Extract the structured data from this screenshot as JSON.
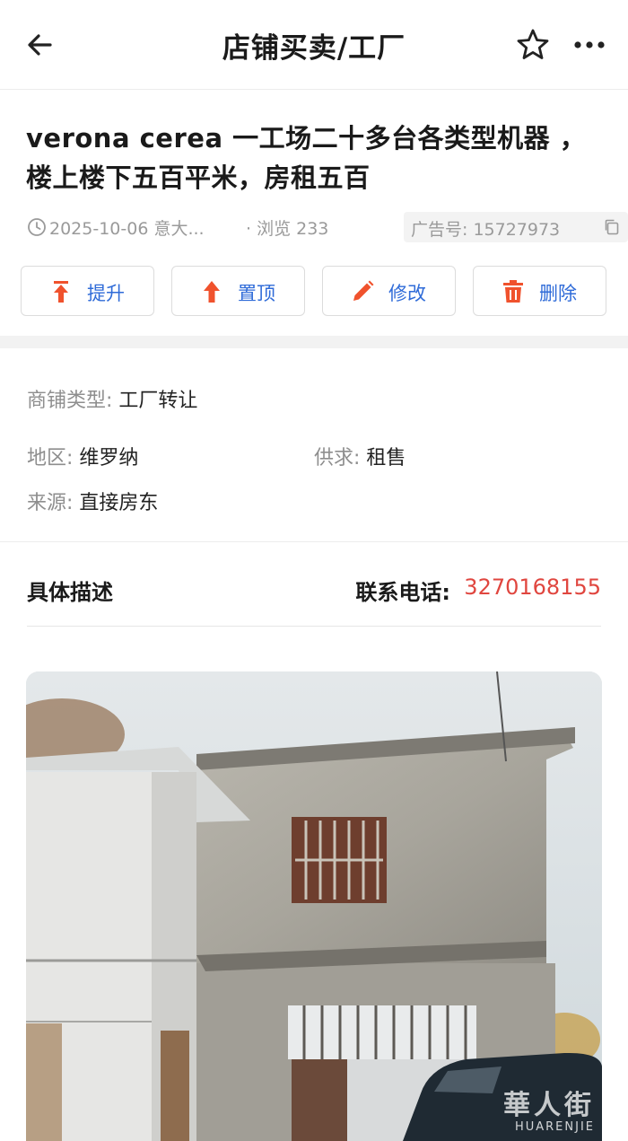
{
  "header": {
    "title": "店铺买卖/工厂",
    "back_icon": "arrow-left-icon",
    "favorite_icon": "star-outline-icon",
    "more_icon": "more-dots-icon"
  },
  "listing": {
    "title": "verona cerea 一工场二十多台各类型机器 ，楼上楼下五百平米，房租五百",
    "date_location": "2025-10-06 意大...",
    "views": "· 浏览 233",
    "ad_number": "广告号: 15727973"
  },
  "actions": [
    {
      "label": "提升",
      "icon": "boost-arrow-icon",
      "color": "#f0522d"
    },
    {
      "label": "置顶",
      "icon": "pin-top-arrow-icon",
      "color": "#f0522d"
    },
    {
      "label": "修改",
      "icon": "pencil-icon",
      "color": "#f0522d"
    },
    {
      "label": "删除",
      "icon": "trash-icon",
      "color": "#f0522d"
    }
  ],
  "details": {
    "shop_type_label": "商铺类型:",
    "shop_type_value": "工厂转让",
    "region_label": "地区:",
    "region_value": "维罗纳",
    "supply_label": "供求:",
    "supply_value": "租售",
    "source_label": "来源:",
    "source_value": "直接房东"
  },
  "description": {
    "heading": "具体描述",
    "phone_label": "联系电话:",
    "phone_value": "3270168155"
  },
  "photo": {
    "watermark_cn": "華人街",
    "watermark_en": "HUARENJIE"
  },
  "colors": {
    "accent_blue": "#2f6bd8",
    "action_orange": "#f0522d",
    "phone_red": "#e0463f"
  }
}
